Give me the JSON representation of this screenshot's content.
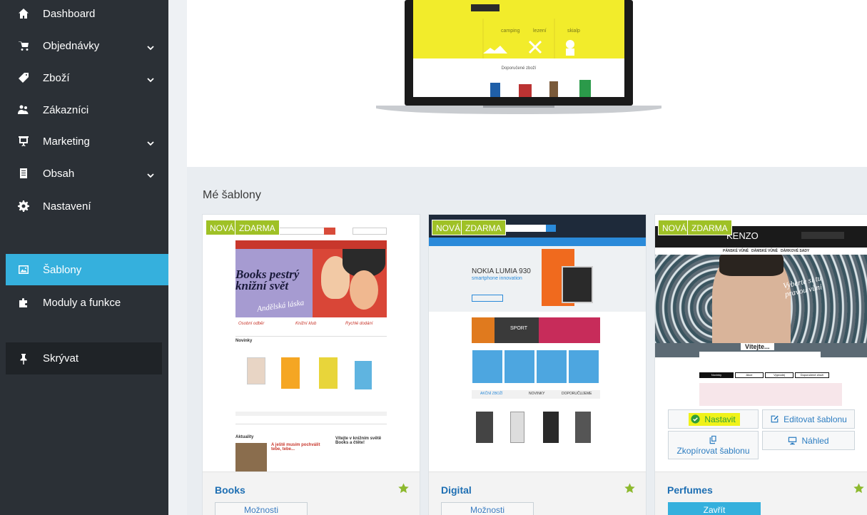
{
  "sidebar": {
    "items": [
      {
        "label": "Dashboard",
        "icon": "home-icon"
      },
      {
        "label": "Objednávky",
        "icon": "cart-icon",
        "has_children": true
      },
      {
        "label": "Zboží",
        "icon": "tag-icon",
        "has_children": true
      },
      {
        "label": "Zákazníci",
        "icon": "users-icon"
      },
      {
        "label": "Marketing",
        "icon": "presentation-icon",
        "has_children": true
      },
      {
        "label": "Obsah",
        "icon": "document-icon",
        "has_children": true
      },
      {
        "label": "Nastavení",
        "icon": "gear-icon"
      },
      {
        "label": "Šablony",
        "icon": "image-icon",
        "active": true
      },
      {
        "label": "Moduly a funkce",
        "icon": "puzzle-icon"
      }
    ],
    "hide_label": "Skrývat"
  },
  "main": {
    "section_title": "Mé šablony",
    "laptop_preview": {
      "categories": [
        "camping",
        "lezení",
        "skialp"
      ],
      "subtitle": "Doporučené zboží"
    },
    "templates": [
      {
        "name": "Books",
        "badges": [
          "NOVÁ",
          "ZDARMA"
        ],
        "action": "Možnosti",
        "preview": {
          "banner_title": "Books pestrý knižní svět",
          "banner_sub": "Andělská láska",
          "features": [
            "Osobní odběr",
            "Knižní klub",
            "Rychlé dodání"
          ],
          "novinky": "Novinky",
          "aktuality": "Aktuality",
          "welcome": "Vítejte v knižním světě Books a čtěte!",
          "news_item": "A ještě musím pochválit tebe, tebe..."
        }
      },
      {
        "name": "Digital",
        "badges": [
          "NOVÁ",
          "ZDARMA"
        ],
        "action": "Možnosti",
        "preview": {
          "hero_title": "NOKIA LUMIA 930",
          "hero_sub": "smartphone innovation",
          "sport": "SPORT",
          "tabs": [
            "AKČNÍ ZBOŽÍ",
            "NOVINKY",
            "DOPORUČUJEME"
          ]
        }
      },
      {
        "name": "Perfumes",
        "badges": [
          "NOVÁ",
          "ZDARMA"
        ],
        "action": "Zavřít",
        "preview": {
          "brand": "KENZO",
          "nav": [
            "PÁNSKÉ VŮNĚ",
            "DÁMSKÉ VŮNĚ",
            "DÁRKOVÉ SADY"
          ],
          "tagline": "Vyberte si tu pravou vůni",
          "welcome": "Vítejte...",
          "tabs": [
            "Novinky",
            "Akce",
            "Výprodej",
            "Doporučené zboží"
          ]
        },
        "hover_actions": {
          "set": "Nastavit",
          "edit": "Editovat šablonu",
          "copy": "Zkopírovat šablonu",
          "preview": "Náhled"
        }
      }
    ]
  },
  "colors": {
    "sidebar_bg": "#2b3036",
    "active": "#35b0dd",
    "badge": "#9fc126",
    "link": "#1e6fb3",
    "highlight": "#f0f21a"
  }
}
